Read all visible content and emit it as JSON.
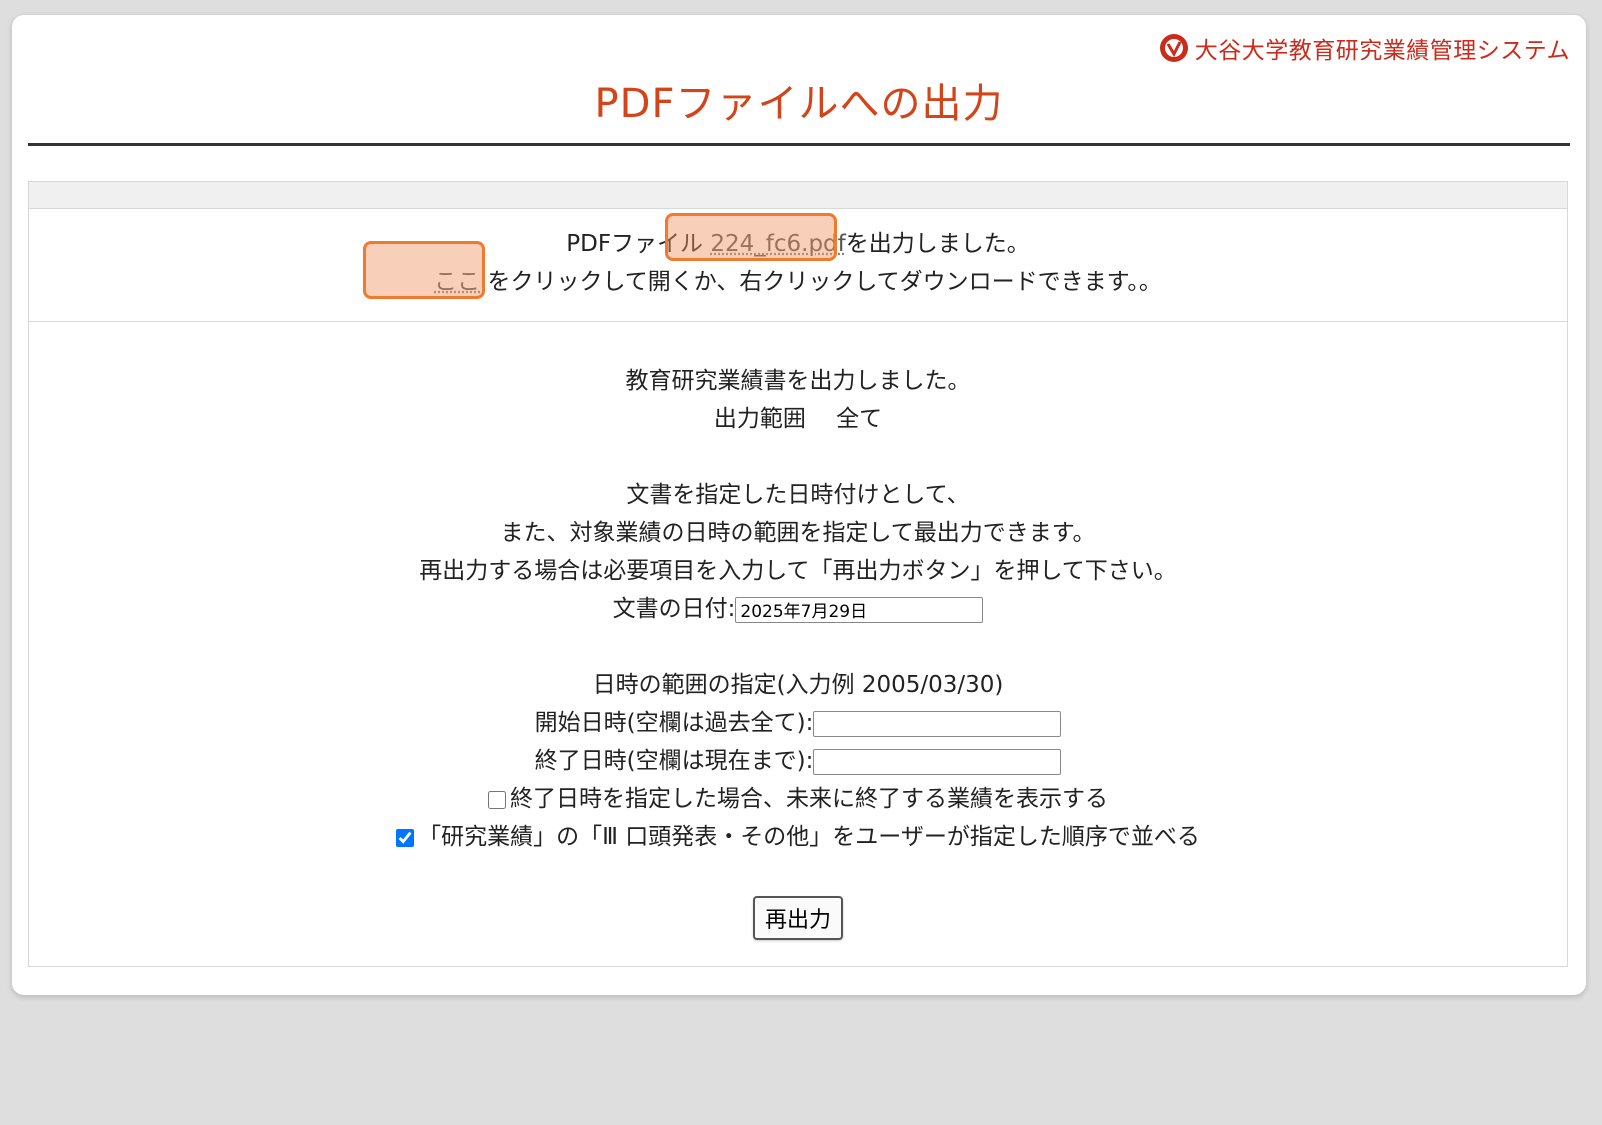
{
  "brand": {
    "name": "大谷大学教育研究業績管理システム"
  },
  "page": {
    "title": "PDFファイルへの出力"
  },
  "notice": {
    "line1_prefix": "PDFファイル",
    "filename": "224_fc6.pdf",
    "line1_suffix": "を出力しました。",
    "link_text": "ここ",
    "line2_suffix": "をクリックして開くか、右クリックしてダウンロードできます。。"
  },
  "main": {
    "output_done": "教育研究業績書を出力しました。",
    "range_label": "出力範囲　 全て",
    "desc1": "文書を指定した日時付けとして、",
    "desc2": "また、対象業績の日時の範囲を指定して最出力できます。",
    "desc3": "再出力する場合は必要項目を入力して「再出力ボタン」を押して下さい。",
    "doc_date_label": "文書の日付:",
    "doc_date_value": "2025年7月29日",
    "range_title": "日時の範囲の指定(入力例 2005/03/30)",
    "start_label": "開始日時(空欄は過去全て):",
    "start_value": "",
    "end_label": "終了日時(空欄は現在まで):",
    "end_value": "",
    "future_label": "終了日時を指定した場合、未来に終了する業績を表示する",
    "future_checked": false,
    "order_label": "「研究業績」の「Ⅲ 口頭発表・その他」をユーザーが指定した順序で並べる",
    "order_checked": true,
    "reoutput_button": "再出力"
  },
  "colors": {
    "accent": "#d2451b",
    "brand": "#cc2a1a",
    "highlight": "#f07a30"
  }
}
